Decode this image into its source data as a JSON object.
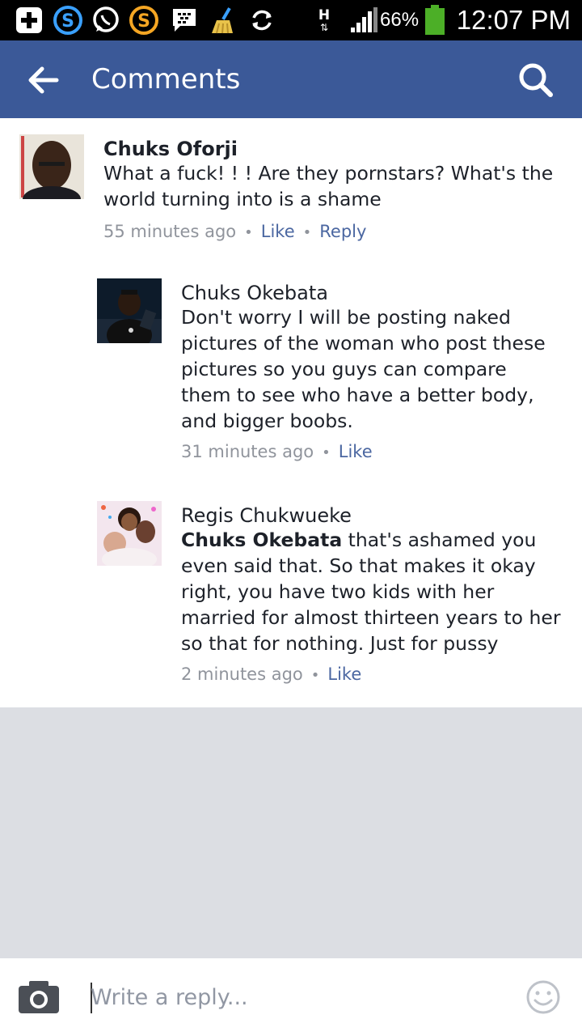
{
  "status_bar": {
    "network_label": "H",
    "battery": "66%",
    "time": "12:07 PM"
  },
  "header": {
    "title": "Comments"
  },
  "comments": [
    {
      "author": "Chuks Oforji",
      "text": "What a fuck! ! !  Are they pornstars? What's  the world turning into is a shame",
      "time": "55 minutes ago",
      "like": "Like",
      "reply": "Reply"
    },
    {
      "author": "Chuks Okebata",
      "text": "Don't worry I will be posting naked pictures of the woman who post these pictures so you guys can compare them to see who have a better body, and bigger boobs.",
      "time": "31 minutes ago",
      "like": "Like"
    },
    {
      "author": "Regis Chukwueke",
      "mention": "Chuks Okebata",
      "text": " that's ashamed you even said that. So that makes it okay right, you have two kids with her married for almost thirteen years to her so that for nothing. Just for pussy",
      "time": "2 minutes ago",
      "like": "Like"
    }
  ],
  "composer": {
    "placeholder": "Write a reply..."
  },
  "colors": {
    "brand": "#3b5998",
    "link": "#4b67a1",
    "meta": "#90949c",
    "background_gray": "#dcdee3"
  },
  "icons": [
    "plus-icon",
    "skype-icon",
    "whatsapp-icon",
    "s-app-icon",
    "bbm-icon",
    "cleaner-icon",
    "sync-icon",
    "signal-icon",
    "battery-icon",
    "back-arrow-icon",
    "search-icon",
    "camera-icon",
    "emoji-icon"
  ]
}
